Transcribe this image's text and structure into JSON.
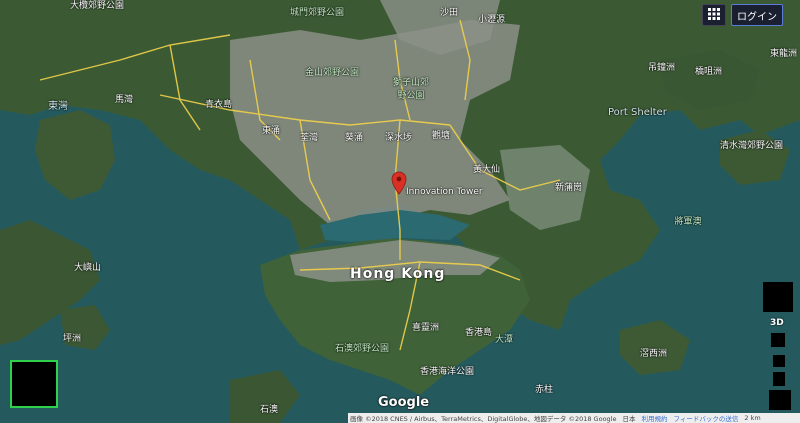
{
  "header": {
    "login_label": "ログイン",
    "grid_icon": "apps-grid-icon"
  },
  "map": {
    "city_label": "Hong Kong",
    "marker_label": "Innovation Tower",
    "marker_icon": "map-pin-icon",
    "place_labels": [
      "大欖郊野公園",
      "城門郊野公園",
      "沙田",
      "小瀝源",
      "金山郊野公園",
      "獅子山郊野公園",
      "馬灣",
      "青衣島",
      "東涌",
      "荃灣",
      "葵涌",
      "深水埗",
      "黃大仙",
      "觀塘",
      "新蒲崗",
      "將軍澳",
      "清水灣郊野公園",
      "吊鐘洲",
      "橋咀洲",
      "滘西洲",
      "東龍洲",
      "大嶼山",
      "坪洲",
      "喜靈洲",
      "香港島",
      "大潭",
      "石澳郊野公園",
      "香港海洋公園",
      "赤柱",
      "石澳",
      "南丫島"
    ],
    "water_labels": [
      "Port Shelter",
      "東灣"
    ],
    "colors": {
      "water": "#245a5e",
      "land": "#3c5a33",
      "urban": "#8a8f88",
      "road": "#f2d24a",
      "marker": "#d93025",
      "minimap_border": "#2fd14a"
    }
  },
  "controls": {
    "label_3d": "3D",
    "minimap_icon": "minimap-icon"
  },
  "footer": {
    "google_logo": "Google",
    "imagery": "画像 ©2018 CNES / Airbus、TerraMetrics、DigitalGlobe、地図データ ©2018 Google",
    "country": "日本",
    "terms": "利用規約",
    "feedback": "フィードバックの送信",
    "scale": "2 km"
  }
}
